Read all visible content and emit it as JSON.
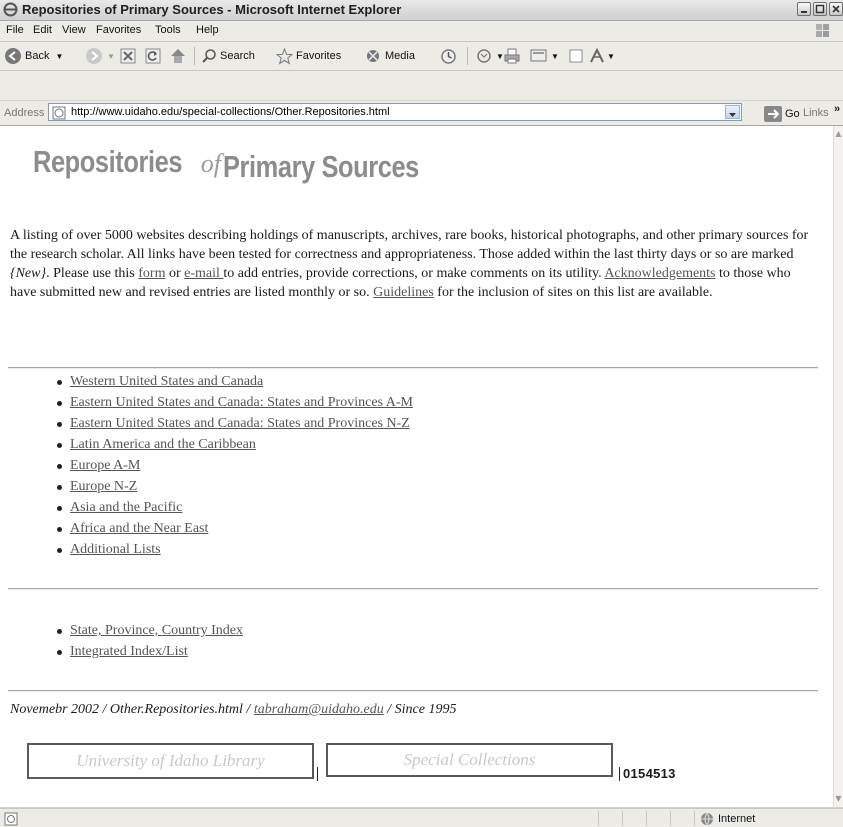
{
  "window": {
    "title": "Repositories of Primary Sources - Microsoft Internet Explorer"
  },
  "menu": {
    "file": "File",
    "edit": "Edit",
    "view": "View",
    "favorites": "Favorites",
    "tools": "Tools",
    "help": "Help"
  },
  "toolbar": {
    "back": "Back",
    "search": "Search",
    "favorites": "Favorites",
    "media": "Media"
  },
  "address": {
    "label": "Address",
    "url": "http://www.uidaho.edu/special-collections/Other.Repositories.html",
    "go": "Go",
    "links": "Links"
  },
  "page": {
    "title_part1": "Repositories",
    "title_of": "of",
    "title_part2": "Primary Sources",
    "intro": {
      "t1": "A listing of over 5000 websites describing holdings of manuscripts, archives, rare books, historical photographs, and other primary sources for the research scholar. All links have been tested for correctness and appropriateness. Those added within the last thirty days or so are marked ",
      "new_tag": "{New}",
      "t2": ". Please use this ",
      "form_link": "form",
      "t3": " or ",
      "email_link": "e-mail ",
      "t4": "to add entries, provide corrections, or make comments on its utility. ",
      "ack_link": "Acknowledgements",
      "t5": " to those who have submitted new and revised entries are listed monthly or so. ",
      "guidelines_link": "Guidelines",
      "t6": " for the inclusion of sites on this list are available."
    },
    "regions": [
      "Western United States and Canada",
      "Eastern United States and Canada: States and Provinces A-M",
      "Eastern United States and Canada: States and Provinces N-Z",
      "Latin America and the Caribbean",
      "Europe A-M",
      "Europe N-Z",
      "Asia and the Pacific",
      "Africa and the Near East",
      "Additional Lists"
    ],
    "indexes": [
      "State, Province, Country Index",
      "Integrated Index/List"
    ],
    "footer": {
      "t1": "Novemebr 2002 / Other.Repositories.html / ",
      "email": "tabraham@uidaho.edu",
      "t2": " / Since 1995"
    },
    "logo_library": "University of Idaho Library",
    "logo_special": "Special Collections",
    "counter": "0154513"
  },
  "status": {
    "zone": "Internet"
  }
}
